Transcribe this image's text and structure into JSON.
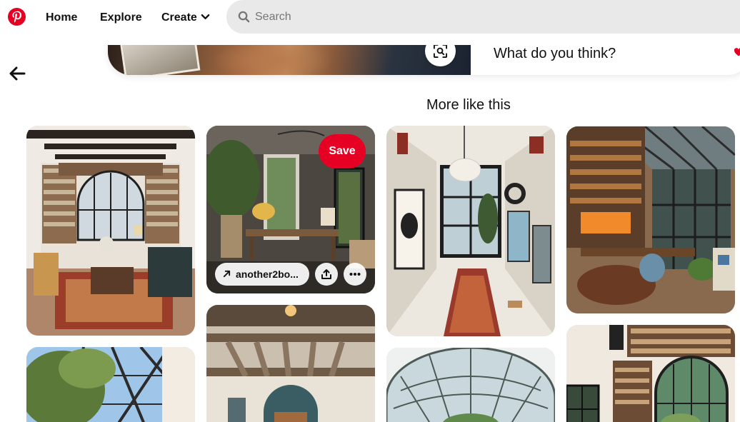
{
  "header": {
    "logo_icon": "pinterest-logo-icon",
    "nav": {
      "home": "Home",
      "explore": "Explore",
      "create": "Create"
    },
    "create_chevron_icon": "chevron-down-icon",
    "search": {
      "icon": "search-icon",
      "placeholder": "Search",
      "value": ""
    }
  },
  "pin": {
    "comment_prompt": "What do you think?",
    "lens_icon": "visual-search-icon",
    "back_icon": "back-arrow-icon"
  },
  "related": {
    "title": "More like this",
    "hovered_pin": {
      "save_label": "Save",
      "link_label": "another2bo...",
      "link_icon": "external-link-arrow-icon",
      "share_icon": "share-icon",
      "more_icon": "more-options-icon"
    }
  },
  "colors": {
    "brand_red": "#e60023",
    "search_bg": "#e9e9e9",
    "text": "#111111"
  }
}
